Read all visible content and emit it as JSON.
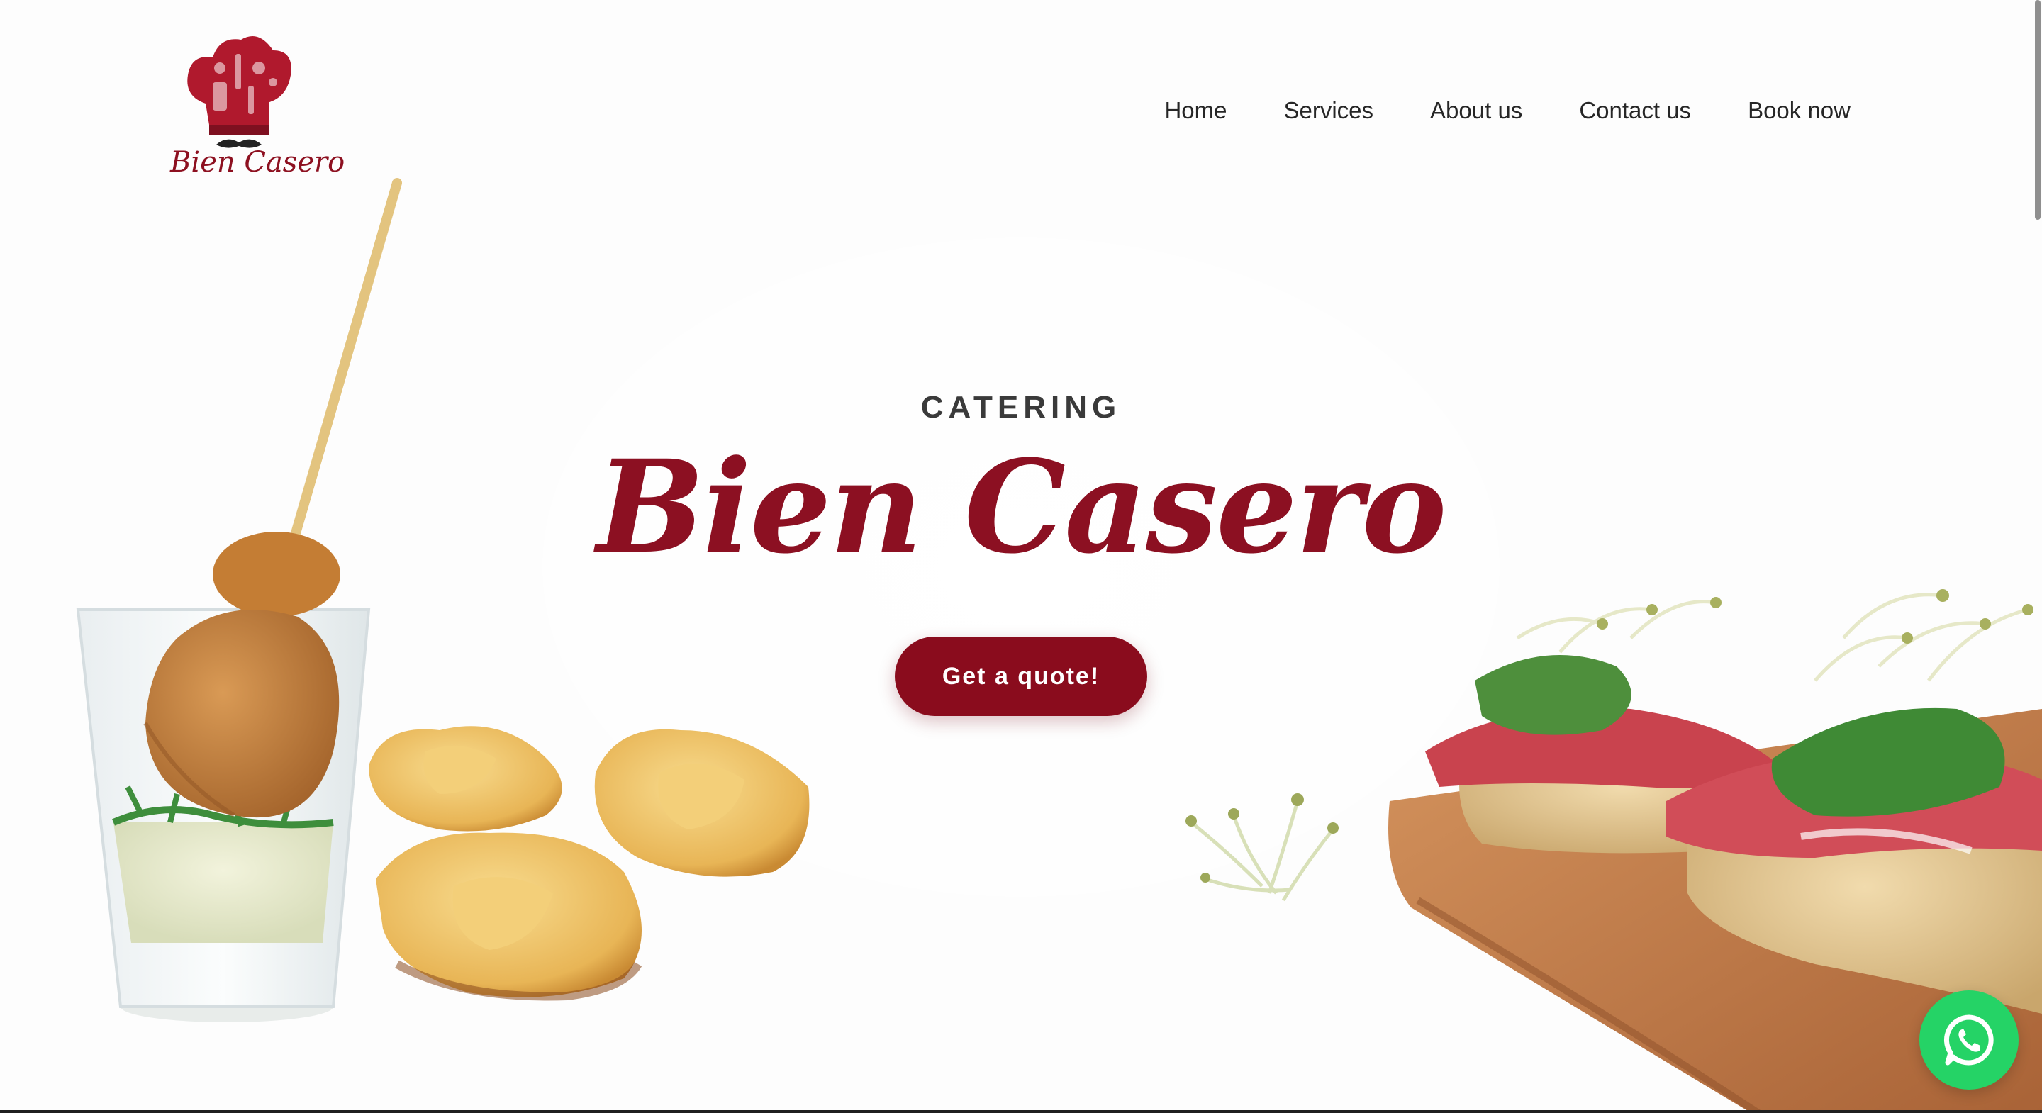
{
  "header": {
    "logo_text": "Bien Casero",
    "nav": [
      {
        "label": "Home"
      },
      {
        "label": "Services"
      },
      {
        "label": "About us"
      },
      {
        "label": "Contact us"
      },
      {
        "label": "Book now"
      }
    ]
  },
  "hero": {
    "eyebrow": "CATERING",
    "title": "Bien Casero",
    "cta_label": "Get a quote!"
  },
  "floating": {
    "icon": "whatsapp-icon"
  },
  "colors": {
    "brand": "#8a0c1d",
    "whatsapp": "#25d366",
    "text": "#262626"
  }
}
